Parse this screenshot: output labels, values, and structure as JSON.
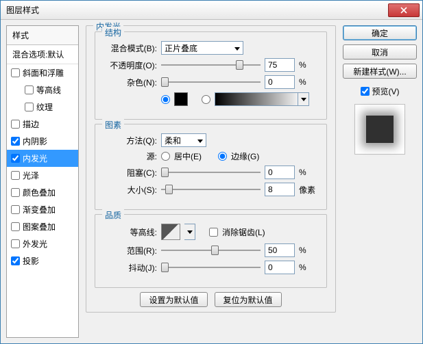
{
  "title": "图层样式",
  "sidebar": {
    "header": "样式",
    "sub": "混合选项:默认",
    "items": [
      {
        "label": "斜面和浮雕",
        "checked": false
      },
      {
        "label": "等高线",
        "checked": false,
        "indent": true
      },
      {
        "label": "纹理",
        "checked": false,
        "indent": true
      },
      {
        "label": "描边",
        "checked": false
      },
      {
        "label": "内阴影",
        "checked": true
      },
      {
        "label": "内发光",
        "checked": true,
        "selected": true
      },
      {
        "label": "光泽",
        "checked": false
      },
      {
        "label": "颜色叠加",
        "checked": false
      },
      {
        "label": "渐变叠加",
        "checked": false
      },
      {
        "label": "图案叠加",
        "checked": false
      },
      {
        "label": "外发光",
        "checked": false
      },
      {
        "label": "投影",
        "checked": true
      }
    ]
  },
  "panel": {
    "title": "内发光",
    "structure": {
      "legend": "结构",
      "blend_label": "混合模式(B):",
      "blend_value": "正片叠底",
      "opacity_label": "不透明度(O):",
      "opacity_value": "75",
      "opacity_unit": "%",
      "noise_label": "杂色(N):",
      "noise_value": "0",
      "noise_unit": "%"
    },
    "elements": {
      "legend": "图素",
      "method_label": "方法(Q):",
      "method_value": "柔和",
      "source_label": "源:",
      "source_center": "居中(E)",
      "source_edge": "边缘(G)",
      "choke_label": "阻塞(C):",
      "choke_value": "0",
      "choke_unit": "%",
      "size_label": "大小(S):",
      "size_value": "8",
      "size_unit": "像素"
    },
    "quality": {
      "legend": "品质",
      "contour_label": "等高线:",
      "antialias_label": "消除锯齿(L)",
      "range_label": "范围(R):",
      "range_value": "50",
      "range_unit": "%",
      "jitter_label": "抖动(J):",
      "jitter_value": "0",
      "jitter_unit": "%"
    },
    "set_default": "设置为默认值",
    "reset_default": "复位为默认值"
  },
  "buttons": {
    "ok": "确定",
    "cancel": "取消",
    "new_style": "新建样式(W)...",
    "preview": "预览(V)"
  }
}
